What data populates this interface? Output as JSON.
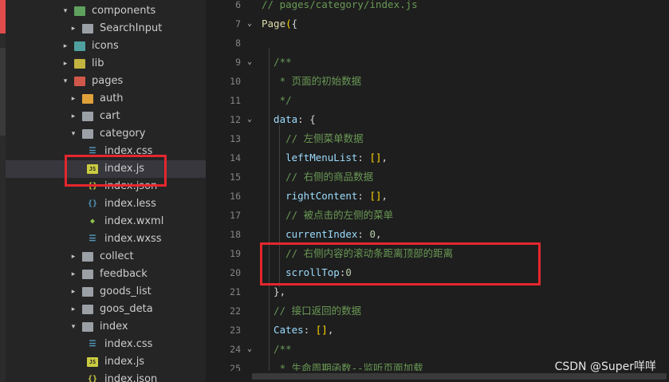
{
  "explorer": {
    "items": [
      {
        "label": "components",
        "icon": "folder-green",
        "arrow": "▾",
        "depth": 2,
        "expanded": true
      },
      {
        "label": "SearchInput",
        "icon": "folder-gray",
        "arrow": "▸",
        "depth": 3
      },
      {
        "label": "icons",
        "icon": "folder-teal",
        "arrow": "▸",
        "depth": 2
      },
      {
        "label": "lib",
        "icon": "folder-yellow",
        "arrow": "▸",
        "depth": 2
      },
      {
        "label": "pages",
        "icon": "folder-red",
        "arrow": "▾",
        "depth": 2,
        "expanded": true
      },
      {
        "label": "auth",
        "icon": "folder-orange",
        "arrow": "▸",
        "depth": 3
      },
      {
        "label": "cart",
        "icon": "folder-gray",
        "arrow": "▸",
        "depth": 3
      },
      {
        "label": "category",
        "icon": "folder-gray",
        "arrow": "▾",
        "depth": 3,
        "expanded": true
      },
      {
        "label": "index.css",
        "icon": "css",
        "arrow": "",
        "depth": 4
      },
      {
        "label": "index.js",
        "icon": "js",
        "arrow": "",
        "depth": 4,
        "selected": true
      },
      {
        "label": "index.json",
        "icon": "json",
        "arrow": "",
        "depth": 4
      },
      {
        "label": "index.less",
        "icon": "less",
        "arrow": "",
        "depth": 4
      },
      {
        "label": "index.wxml",
        "icon": "wxml",
        "arrow": "",
        "depth": 4
      },
      {
        "label": "index.wxss",
        "icon": "css",
        "arrow": "",
        "depth": 4
      },
      {
        "label": "collect",
        "icon": "folder-gray",
        "arrow": "▸",
        "depth": 3
      },
      {
        "label": "feedback",
        "icon": "folder-gray",
        "arrow": "▸",
        "depth": 3
      },
      {
        "label": "goods_list",
        "icon": "folder-gray",
        "arrow": "▸",
        "depth": 3
      },
      {
        "label": "goos_deta",
        "icon": "folder-gray",
        "arrow": "▸",
        "depth": 3
      },
      {
        "label": "index",
        "icon": "folder-gray",
        "arrow": "▾",
        "depth": 3,
        "expanded": true
      },
      {
        "label": "index.css",
        "icon": "css",
        "arrow": "",
        "depth": 4
      },
      {
        "label": "index.js",
        "icon": "js",
        "arrow": "",
        "depth": 4
      },
      {
        "label": "index.json",
        "icon": "json",
        "arrow": "",
        "depth": 4
      }
    ],
    "icon_glyphs": {
      "css": "☰",
      "js": "JS",
      "json": "{}",
      "less": "{}",
      "wxml": "◆"
    }
  },
  "editor": {
    "lines": [
      {
        "num": "6",
        "fold": "",
        "tokens": [
          [
            "c-comment",
            "// pages/category/index.js"
          ]
        ]
      },
      {
        "num": "7",
        "fold": "⌄",
        "tokens": [
          [
            "c-func",
            "Page"
          ],
          [
            "c-bracket",
            "("
          ],
          [
            "c-punc",
            "{"
          ]
        ]
      },
      {
        "num": "8",
        "fold": "",
        "tokens": []
      },
      {
        "num": "9",
        "fold": "⌄",
        "tokens": [
          [
            "c-comment",
            "  /**"
          ]
        ]
      },
      {
        "num": "10",
        "fold": "",
        "tokens": [
          [
            "c-comment",
            "   * 页面的初始数据"
          ]
        ]
      },
      {
        "num": "11",
        "fold": "",
        "tokens": [
          [
            "c-comment",
            "   */"
          ]
        ]
      },
      {
        "num": "12",
        "fold": "⌄",
        "tokens": [
          [
            "c-key",
            "  data"
          ],
          [
            "c-punc",
            ": {"
          ]
        ]
      },
      {
        "num": "13",
        "fold": "",
        "tokens": [
          [
            "c-comment",
            "    // 左侧菜单数据"
          ]
        ]
      },
      {
        "num": "14",
        "fold": "",
        "tokens": [
          [
            "c-key",
            "    leftMenuList"
          ],
          [
            "c-punc",
            ": "
          ],
          [
            "c-bracket",
            "[]"
          ],
          [
            "c-punc",
            ","
          ]
        ]
      },
      {
        "num": "15",
        "fold": "",
        "tokens": [
          [
            "c-comment",
            "    // 右侧的商品数据"
          ]
        ]
      },
      {
        "num": "16",
        "fold": "",
        "tokens": [
          [
            "c-key",
            "    rightContent"
          ],
          [
            "c-punc",
            ": "
          ],
          [
            "c-bracket",
            "[]"
          ],
          [
            "c-punc",
            ","
          ]
        ]
      },
      {
        "num": "17",
        "fold": "",
        "tokens": [
          [
            "c-comment",
            "    // 被点击的左侧的菜单"
          ]
        ]
      },
      {
        "num": "18",
        "fold": "",
        "tokens": [
          [
            "c-key",
            "    currentIndex"
          ],
          [
            "c-punc",
            ": "
          ],
          [
            "c-num",
            "0"
          ],
          [
            "c-punc",
            ","
          ]
        ]
      },
      {
        "num": "19",
        "fold": "",
        "tokens": [
          [
            "c-comment",
            "    // 右侧内容的滚动条距离顶部的距离"
          ]
        ]
      },
      {
        "num": "20",
        "fold": "",
        "tokens": [
          [
            "c-key",
            "    scrollTop"
          ],
          [
            "c-punc",
            ":"
          ],
          [
            "c-num",
            "0"
          ]
        ]
      },
      {
        "num": "21",
        "fold": "",
        "tokens": [
          [
            "c-punc",
            "  },"
          ]
        ]
      },
      {
        "num": "22",
        "fold": "",
        "tokens": [
          [
            "c-comment",
            "  // 接口返回的数据"
          ]
        ]
      },
      {
        "num": "23",
        "fold": "",
        "tokens": [
          [
            "c-key",
            "  Cates"
          ],
          [
            "c-punc",
            ": "
          ],
          [
            "c-bracket",
            "[]"
          ],
          [
            "c-punc",
            ","
          ]
        ]
      },
      {
        "num": "24",
        "fold": "⌄",
        "tokens": [
          [
            "c-comment",
            "  /**"
          ]
        ]
      },
      {
        "num": "25",
        "fold": "",
        "tokens": [
          [
            "c-comment",
            "   * 生命周期函数--监听页面加载"
          ]
        ]
      }
    ]
  },
  "watermark": "CSDN @Super咩咩",
  "colors": {
    "highlight_box": "#e5262d",
    "selection": "#37373d"
  }
}
